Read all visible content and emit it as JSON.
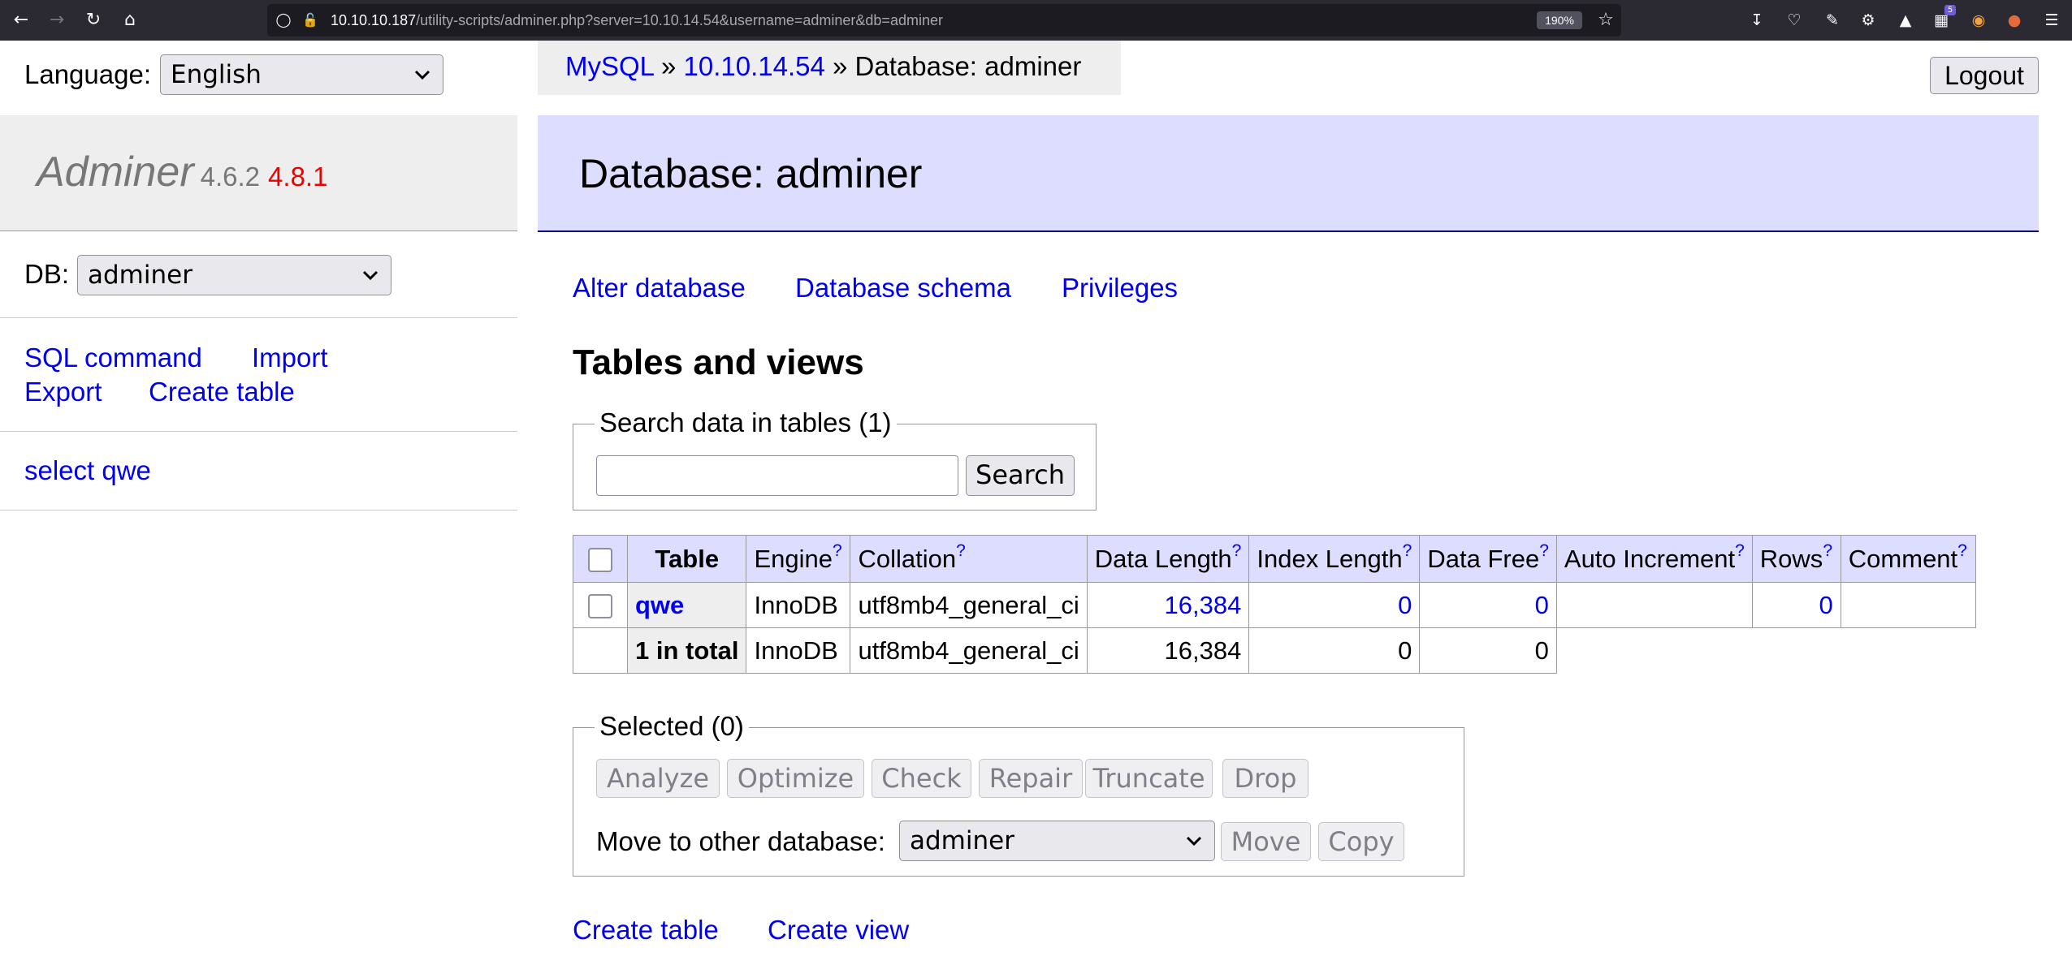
{
  "browser": {
    "url_host": "10.10.10.187",
    "url_path": "/utility-scripts/adminer.php?server=10.10.14.54&username=adminer&db=adminer",
    "zoom": "190%",
    "extension_badge": "5"
  },
  "sidebar": {
    "language_label": "Language:",
    "language_value": "English",
    "brand_name": "Adminer",
    "version": "4.6.2",
    "new_version": "4.8.1",
    "db_label": "DB:",
    "db_value": "adminer",
    "links": {
      "sql_command": "SQL command",
      "import": "Import",
      "export": "Export",
      "create_table": "Create table"
    },
    "tables": [
      {
        "label": "select qwe"
      }
    ]
  },
  "breadcrumb": {
    "driver": "MySQL",
    "sep1": "»",
    "server": "10.10.14.54",
    "sep2": "»",
    "current": "Database: adminer"
  },
  "logout_label": "Logout",
  "page_title": "Database: adminer",
  "actions": {
    "alter_database": "Alter database",
    "database_schema": "Database schema",
    "privileges": "Privileges"
  },
  "section_title": "Tables and views",
  "search": {
    "legend": "Search data in tables (1)",
    "value": "",
    "button": "Search"
  },
  "table": {
    "headers": {
      "table": "Table",
      "engine": "Engine",
      "collation": "Collation",
      "data_length": "Data Length",
      "index_length": "Index Length",
      "data_free": "Data Free",
      "auto_increment": "Auto Increment",
      "rows": "Rows",
      "comment": "Comment",
      "help_mark": "?"
    },
    "rows": [
      {
        "name": "qwe",
        "engine": "InnoDB",
        "collation": "utf8mb4_general_ci",
        "data_length": "16,384",
        "index_length": "0",
        "data_free": "0",
        "auto_increment": "",
        "rows": "0",
        "comment": ""
      }
    ],
    "total": {
      "label": "1 in total",
      "engine": "InnoDB",
      "collation": "utf8mb4_general_ci",
      "data_length": "16,384",
      "index_length": "0",
      "data_free": "0"
    }
  },
  "selected": {
    "legend": "Selected (0)",
    "buttons": {
      "analyze": "Analyze",
      "optimize": "Optimize",
      "check": "Check",
      "repair": "Repair",
      "truncate": "Truncate",
      "drop": "Drop"
    },
    "move_label": "Move to other database:",
    "move_db": "adminer",
    "move_button": "Move",
    "copy_button": "Copy"
  },
  "footer_links": {
    "create_table": "Create table",
    "create_view": "Create view"
  },
  "colors": {
    "link": "#0000ee",
    "header_bg": "#ddddff",
    "sidebar_bg": "#eeeeee",
    "new_version": "#ee0000",
    "browser_toolbar": "#2b2a33"
  }
}
